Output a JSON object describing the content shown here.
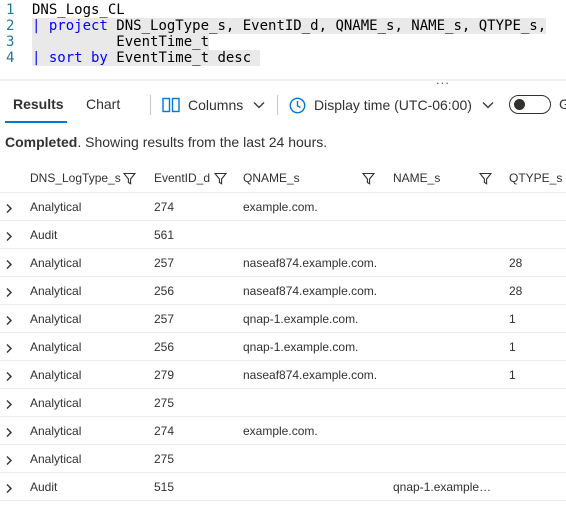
{
  "editor": {
    "lines": [
      {
        "num": "1",
        "parts": [
          {
            "text": "DNS_Logs_CL",
            "cls": ""
          }
        ]
      },
      {
        "num": "2",
        "parts": [
          {
            "text": "| ",
            "cls": "pipe"
          },
          {
            "text": "project",
            "cls": "kw"
          },
          {
            "text": " DNS_LogType_s, EventID_d, QNAME_s, NAME_s, QTYPE_s,",
            "cls": ""
          }
        ]
      },
      {
        "num": "3",
        "parts": [
          {
            "text": "          EventTime_t",
            "cls": ""
          }
        ]
      },
      {
        "num": "4",
        "parts": [
          {
            "text": "| ",
            "cls": "pipe"
          },
          {
            "text": "sort by",
            "cls": "kw"
          },
          {
            "text": " EventTime_t desc ",
            "cls": ""
          }
        ]
      }
    ],
    "more_indicator": "..."
  },
  "toolbar": {
    "tabs": [
      {
        "label": "Results",
        "active": true
      },
      {
        "label": "Chart",
        "active": false
      }
    ],
    "columns_label": "Columns",
    "display_time_label": "Display time (UTC-06:00)",
    "toggle_label": "G",
    "toggle_on": false
  },
  "status": {
    "bold": "Completed",
    "rest": ". Showing results from the last 24 hours."
  },
  "table": {
    "columns": [
      {
        "label": "DNS_LogType_s",
        "filter": true
      },
      {
        "label": "EventID_d",
        "filter": true
      },
      {
        "label": "QNAME_s",
        "filter": true
      },
      {
        "label": "NAME_s",
        "filter": true
      },
      {
        "label": "QTYPE_s",
        "filter": false
      }
    ],
    "rows": [
      {
        "type": "Analytical",
        "event": "274",
        "qname": "example.com.",
        "name": "",
        "qtype": ""
      },
      {
        "type": "Audit",
        "event": "561",
        "qname": "",
        "name": "",
        "qtype": ""
      },
      {
        "type": "Analytical",
        "event": "257",
        "qname": "naseaf874.example.com.",
        "name": "",
        "qtype": "28"
      },
      {
        "type": "Analytical",
        "event": "256",
        "qname": "naseaf874.example.com.",
        "name": "",
        "qtype": "28"
      },
      {
        "type": "Analytical",
        "event": "257",
        "qname": "qnap-1.example.com.",
        "name": "",
        "qtype": "1"
      },
      {
        "type": "Analytical",
        "event": "256",
        "qname": "qnap-1.example.com.",
        "name": "",
        "qtype": "1"
      },
      {
        "type": "Analytical",
        "event": "279",
        "qname": "naseaf874.example.com.",
        "name": "",
        "qtype": "1"
      },
      {
        "type": "Analytical",
        "event": "275",
        "qname": "",
        "name": "",
        "qtype": ""
      },
      {
        "type": "Analytical",
        "event": "274",
        "qname": "example.com.",
        "name": "",
        "qtype": ""
      },
      {
        "type": "Analytical",
        "event": "275",
        "qname": "",
        "name": "",
        "qtype": ""
      },
      {
        "type": "Audit",
        "event": "515",
        "qname": "",
        "name": "qnap-1.example.…",
        "qtype": ""
      }
    ]
  },
  "colors": {
    "accent": "#0078d4",
    "keyword": "#0000ff",
    "line_number": "#237893"
  }
}
